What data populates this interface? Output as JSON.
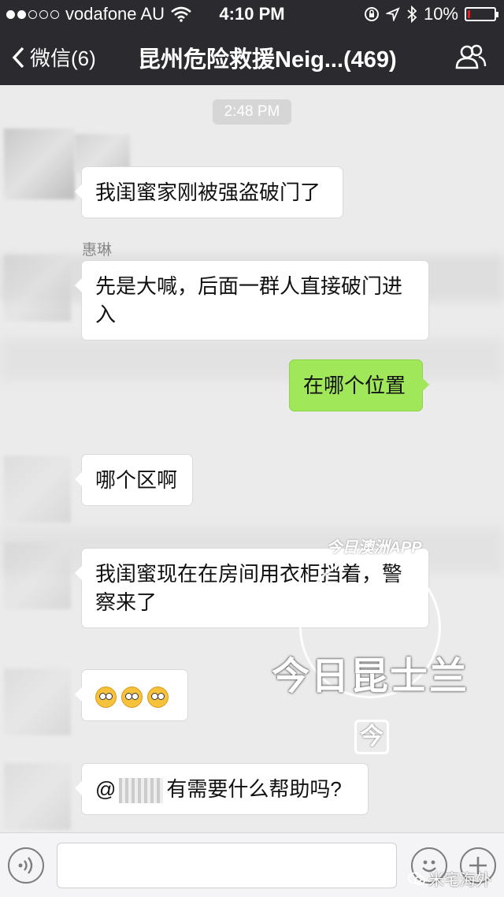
{
  "status_bar": {
    "carrier": "vodafone AU",
    "time": "4:10 PM",
    "battery": "10%",
    "battery_level": 0.1,
    "signal_bars": 2
  },
  "nav": {
    "back_label": "微信(6)",
    "title": "昆州危险救援Neig...(469)"
  },
  "chat": {
    "timestamp": "2:48 PM",
    "messages": [
      {
        "sender": "",
        "text": "我闺蜜家刚被强盗破门了",
        "side": "left"
      },
      {
        "sender": "惠琳",
        "text": "先是大喊，后面一群人直接破门进入",
        "side": "left"
      },
      {
        "sender": "",
        "text": "在哪个位置",
        "side": "right"
      },
      {
        "sender": "",
        "text": "哪个区啊",
        "side": "left"
      },
      {
        "sender": "",
        "text": "我闺蜜现在在房间用衣柜挡着，警察来了",
        "side": "left"
      },
      {
        "sender": "",
        "text": "",
        "emoji_count": 3,
        "side": "left"
      },
      {
        "sender": "",
        "text_prefix": "@",
        "text_suffix": "有需要什么帮助吗?",
        "side": "left"
      }
    ]
  },
  "watermark": {
    "arc_text": "今日澳洲APP",
    "main_text": "今日昆士兰",
    "logo_char": "今"
  },
  "input_bar": {
    "voice_icon": "voice-icon",
    "emoji_icon": "emoji-icon",
    "plus_icon": "plus-icon"
  },
  "brand": "米宅海外",
  "colors": {
    "nav_bg": "#2a2a2f",
    "chat_bg": "#ebebeb",
    "my_bubble": "#a0e75a",
    "their_bubble": "#ffffff",
    "battery_low": "#e02020"
  }
}
